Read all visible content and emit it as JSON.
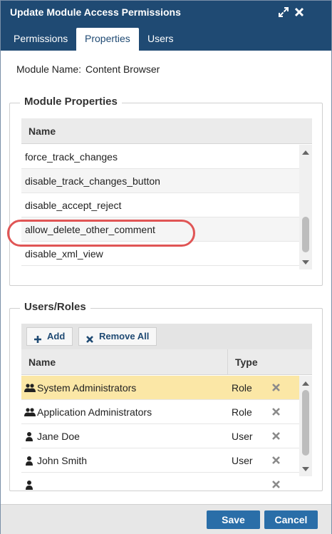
{
  "dialog": {
    "title": "Update Module Access Permissions",
    "icons": {
      "expand": "expand-icon",
      "close": "close-icon"
    },
    "colors": {
      "titlebar": "#1f4a73",
      "button": "#2a6ea8",
      "highlight": "#e05555",
      "selected_row": "#fbe7a6"
    }
  },
  "tabs": [
    {
      "label": "Permissions",
      "active": false
    },
    {
      "label": "Properties",
      "active": true
    },
    {
      "label": "Users",
      "active": false
    }
  ],
  "module": {
    "label": "Module Name:",
    "value": "Content Browser"
  },
  "module_properties": {
    "legend": "Module Properties",
    "column_name": "Name",
    "rows": [
      "force_track_changes",
      "disable_track_changes_button",
      "disable_accept_reject",
      "allow_delete_other_comment",
      "disable_xml_view"
    ],
    "highlighted_row": "allow_delete_other_comment"
  },
  "users_roles": {
    "legend": "Users/Roles",
    "toolbar": {
      "add_label": "Add",
      "remove_all_label": "Remove All"
    },
    "columns": {
      "name": "Name",
      "type": "Type"
    },
    "rows": [
      {
        "name": "System Administrators",
        "type": "Role",
        "icon": "group-icon",
        "selected": true
      },
      {
        "name": "Application Administrators",
        "type": "Role",
        "icon": "group-icon",
        "selected": false
      },
      {
        "name": "Jane Doe",
        "type": "User",
        "icon": "user-icon",
        "selected": false
      },
      {
        "name": "John Smith",
        "type": "User",
        "icon": "user-icon",
        "selected": false
      }
    ]
  },
  "footer": {
    "save_label": "Save",
    "cancel_label": "Cancel"
  }
}
